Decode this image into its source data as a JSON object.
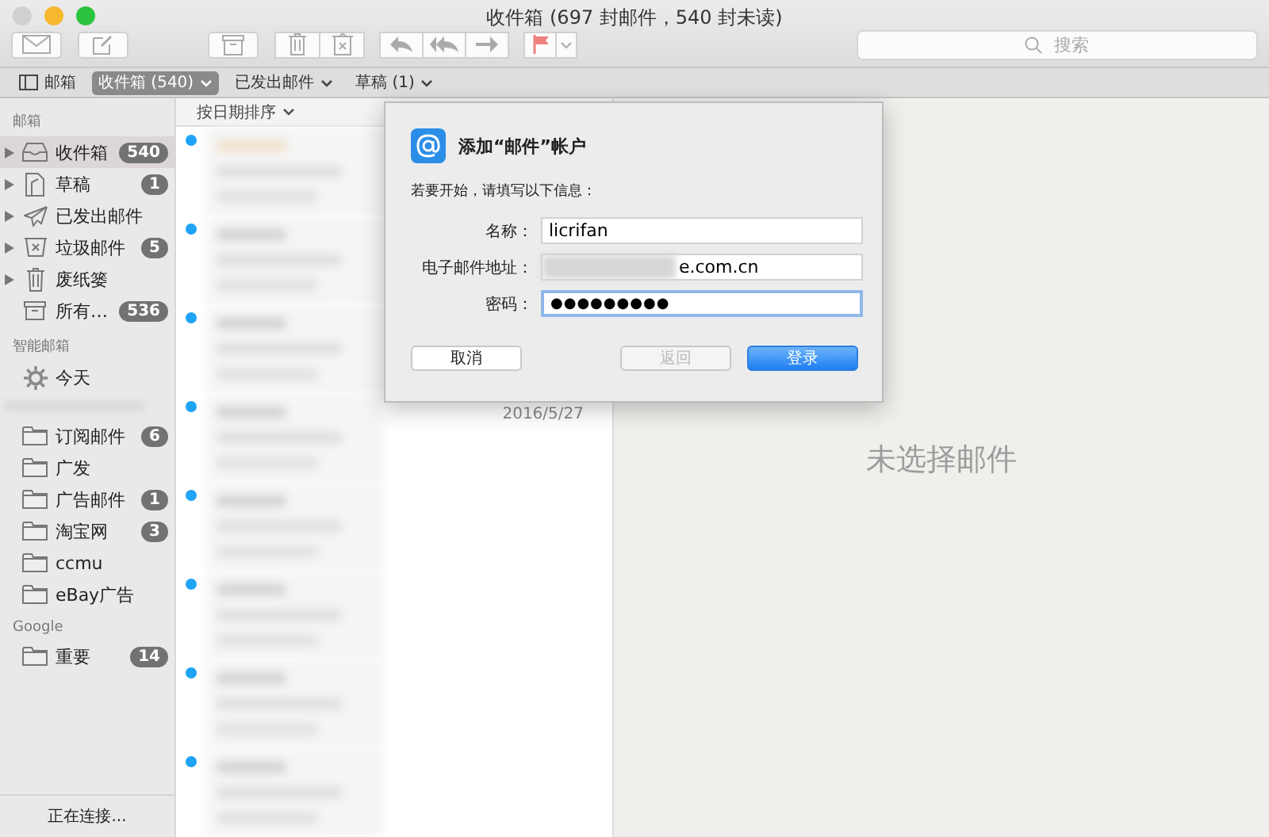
{
  "window": {
    "title": "收件箱 (697 封邮件，540 封未读)"
  },
  "toolbar": {
    "search": {
      "placeholder": "搜索"
    }
  },
  "favorites": [
    {
      "label": "邮箱",
      "kind": "toggle",
      "selected": false
    },
    {
      "label": "收件箱 (540)",
      "kind": "mailbox",
      "selected": true
    },
    {
      "label": "已发出邮件",
      "kind": "mailbox",
      "selected": false
    },
    {
      "label": "草稿 (1)",
      "kind": "mailbox",
      "selected": false
    }
  ],
  "sidebar": {
    "sections": [
      {
        "heading": "邮箱",
        "items": [
          {
            "label": "收件箱",
            "count": "540",
            "kind": "inbox",
            "expandable": true,
            "selected": true
          },
          {
            "label": "草稿",
            "count": "1",
            "kind": "drafts",
            "expandable": true,
            "selected": false
          },
          {
            "label": "已发出邮件",
            "kind": "sent",
            "expandable": true,
            "selected": false
          },
          {
            "label": "垃圾邮件",
            "count": "5",
            "kind": "junk",
            "expandable": true,
            "selected": false
          },
          {
            "label": "废纸篓",
            "kind": "trash",
            "expandable": true,
            "selected": false
          },
          {
            "label": "所有…",
            "count": "536",
            "kind": "archive",
            "expandable": false,
            "selected": false
          }
        ]
      },
      {
        "heading": "智能邮箱",
        "items": [
          {
            "label": "今天",
            "kind": "smart",
            "expandable": false,
            "selected": false
          }
        ]
      },
      {
        "items": [
          {
            "label": "订阅邮件",
            "count": "6",
            "kind": "folder",
            "expandable": false,
            "selected": false
          },
          {
            "label": "广发",
            "kind": "folder",
            "expandable": false,
            "selected": false
          },
          {
            "label": "广告邮件",
            "count": "1",
            "kind": "folder",
            "expandable": false,
            "selected": false
          },
          {
            "label": "淘宝网",
            "count": "3",
            "kind": "folder",
            "expandable": false,
            "selected": false
          },
          {
            "label": "ccmu",
            "kind": "folder",
            "expandable": false,
            "selected": false
          },
          {
            "label": "eBay广告",
            "kind": "folder",
            "expandable": false,
            "selected": false
          }
        ]
      },
      {
        "heading": "Google",
        "items": [
          {
            "label": "重要",
            "count": "14",
            "kind": "folder",
            "expandable": false,
            "selected": false
          }
        ]
      }
    ],
    "status": "正在连接..."
  },
  "message_list": {
    "sort": "按日期排序",
    "messages": [
      {
        "unread": true
      },
      {
        "unread": true
      },
      {
        "unread": true
      },
      {
        "unread": true,
        "date": "2016/5/27"
      },
      {
        "unread": true
      },
      {
        "unread": true
      },
      {
        "unread": true
      },
      {
        "unread": true
      }
    ]
  },
  "preview": {
    "empty_text": "未选择邮件"
  },
  "dialog": {
    "title": "添加“邮件”帐户",
    "intro": "若要开始，请填写以下信息：",
    "fields": [
      {
        "label": "名称：",
        "value": "licrifan",
        "kind": "text",
        "focused": false
      },
      {
        "label": "电子邮件地址：",
        "value": "e.com.cn",
        "kind": "redacted",
        "focused": false
      },
      {
        "label": "密码：",
        "value": "●●●●●●●●●",
        "kind": "password",
        "focused": true
      }
    ],
    "buttons": [
      {
        "label": "取消",
        "disabled": false,
        "default": false
      },
      {
        "label": "返回",
        "disabled": true,
        "default": false
      },
      {
        "label": "登录",
        "disabled": false,
        "default": true
      }
    ]
  }
}
